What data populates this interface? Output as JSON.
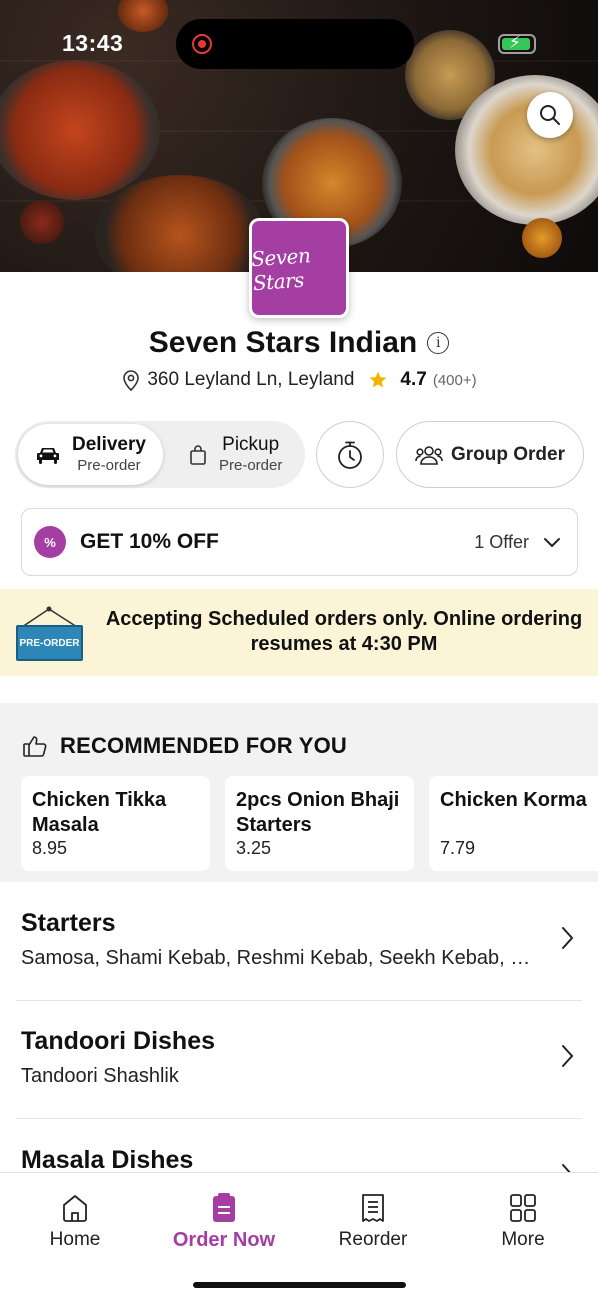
{
  "status_bar": {
    "time": "13:43"
  },
  "restaurant": {
    "logo_text": "Seven Stars",
    "name": "Seven Stars Indian",
    "address": "360 Leyland Ln, Leyland",
    "rating": "4.7",
    "reviews": "(400+)"
  },
  "modes": {
    "delivery": {
      "title": "Delivery",
      "sub": "Pre-order",
      "selected": true
    },
    "pickup": {
      "title": "Pickup",
      "sub": "Pre-order",
      "selected": false
    },
    "group_order_label": "Group Order"
  },
  "offer": {
    "badge": "%",
    "title": "GET 10% OFF",
    "count": "1 Offer"
  },
  "banner": {
    "sign_text": "PRE-ORDER",
    "message": "Accepting Scheduled orders only. Online ordering resumes at 4:30 PM"
  },
  "recommended": {
    "title": "RECOMMENDED FOR YOU",
    "items": [
      {
        "name": "Chicken Tikka Masala",
        "price": "8.95"
      },
      {
        "name": "2pcs Onion Bhaji Starters",
        "price": "3.25"
      },
      {
        "name": "Chicken Korma",
        "price": "7.79"
      }
    ]
  },
  "categories": [
    {
      "title": "Starters",
      "desc": "Samosa, Shami Kebab, Reshmi Kebab, Seekh Kebab, P..."
    },
    {
      "title": "Tandoori Dishes",
      "desc": "Tandoori Shashlik"
    },
    {
      "title": "Masala Dishes",
      "desc": ""
    }
  ],
  "nav": {
    "home": "Home",
    "order_now": "Order Now",
    "reorder": "Reorder",
    "more": "More"
  },
  "colors": {
    "accent": "#a53ea3",
    "banner_bg": "#fcf4d6",
    "star": "#f5b301",
    "preorder_blue": "#2c86b7"
  },
  "icons": [
    "search-icon",
    "info-icon",
    "location-pin-icon",
    "star-icon",
    "car-icon",
    "bag-icon",
    "timer-icon",
    "group-icon",
    "discount-badge-icon",
    "chevron-down-icon",
    "thumbs-up-icon",
    "chevron-right-icon",
    "home-icon",
    "order-icon",
    "receipt-icon",
    "grid-icon"
  ]
}
